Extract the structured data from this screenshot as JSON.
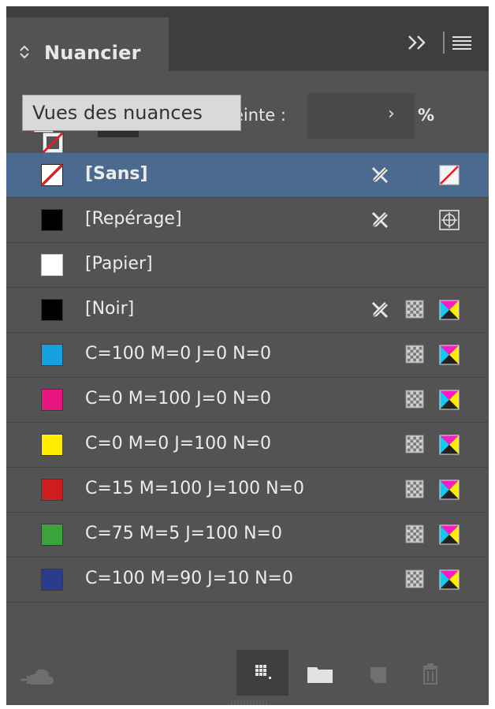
{
  "panel": {
    "title": "Nuancier",
    "icons": [
      "tab-collapse-chevron-icon",
      "overflow-double-chevron-icon",
      "panel-menu-hamburger-icon"
    ]
  },
  "toolbar": {
    "tooltip": "Vues des nuances",
    "tint_label": "einte :",
    "tint_value": "",
    "tint_arrow": "›",
    "percent": "%"
  },
  "swatches": [
    {
      "name": "[Sans]",
      "color": "none",
      "nonedit": true,
      "mode": "none-mode",
      "type": "none",
      "selected": true,
      "bold": true
    },
    {
      "name": "[Repérage]",
      "color": "#000000",
      "nonedit": true,
      "mode": "",
      "type": "registration",
      "selected": false
    },
    {
      "name": "[Papier]",
      "color": "#ffffff",
      "nonedit": false,
      "mode": "",
      "type": "",
      "selected": false
    },
    {
      "name": "[Noir]",
      "color": "#000000",
      "nonedit": true,
      "mode": "process",
      "type": "cmyk",
      "selected": false
    },
    {
      "name": "C=100 M=0 J=0 N=0",
      "color": "#16a0e0",
      "nonedit": false,
      "mode": "process",
      "type": "cmyk",
      "selected": false
    },
    {
      "name": "C=0 M=100 J=0 N=0",
      "color": "#e7157f",
      "nonedit": false,
      "mode": "process",
      "type": "cmyk",
      "selected": false
    },
    {
      "name": "C=0 M=0 J=100 N=0",
      "color": "#ffec00",
      "nonedit": false,
      "mode": "process",
      "type": "cmyk",
      "selected": false
    },
    {
      "name": "C=15 M=100 J=100 N=0",
      "color": "#d01b20",
      "nonedit": false,
      "mode": "process",
      "type": "cmyk",
      "selected": false
    },
    {
      "name": "C=75 M=5 J=100 N=0",
      "color": "#3aa43a",
      "nonedit": false,
      "mode": "process",
      "type": "cmyk",
      "selected": false
    },
    {
      "name": "C=100 M=90 J=10 N=0",
      "color": "#2b3a8a",
      "nonedit": false,
      "mode": "process",
      "type": "cmyk",
      "selected": false
    }
  ],
  "footer": {
    "icons": [
      "creative-cloud-library-icon",
      "swatch-views-icon",
      "new-color-group-icon",
      "new-swatch-icon",
      "delete-swatch-icon"
    ]
  },
  "colors": {
    "panel_bg": "#535353",
    "tab_bar_bg": "#3f3f3f",
    "selected_row": "#4b6a8f",
    "text": "#ececec"
  }
}
